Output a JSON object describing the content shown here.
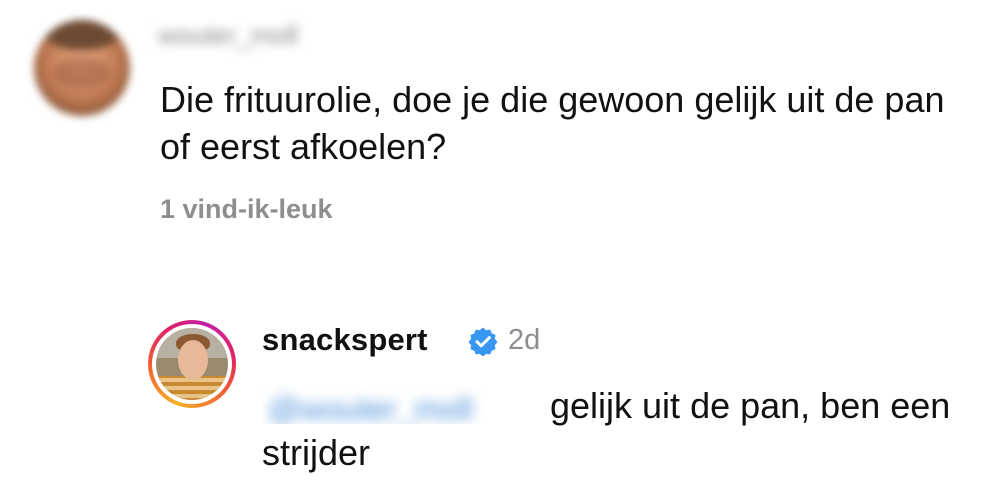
{
  "comment": {
    "username": "wouter_moll",
    "text": "Die frituurolie, doe je die gewoon gelijk uit de pan of eerst afkoelen?",
    "likes": "1 vind-ik-leuk"
  },
  "reply": {
    "username": "snackspert",
    "verified_icon": "verified-badge-icon",
    "time": "2d",
    "mention": "@wouter_moll",
    "text": "gelijk uit de pan, ben een strijder"
  },
  "colors": {
    "text": "#111111",
    "secondary_text": "#8e8e8e",
    "verified_blue": "#3897f0",
    "story_ring_start": "#f7b22b",
    "story_ring_end": "#c220a8"
  }
}
